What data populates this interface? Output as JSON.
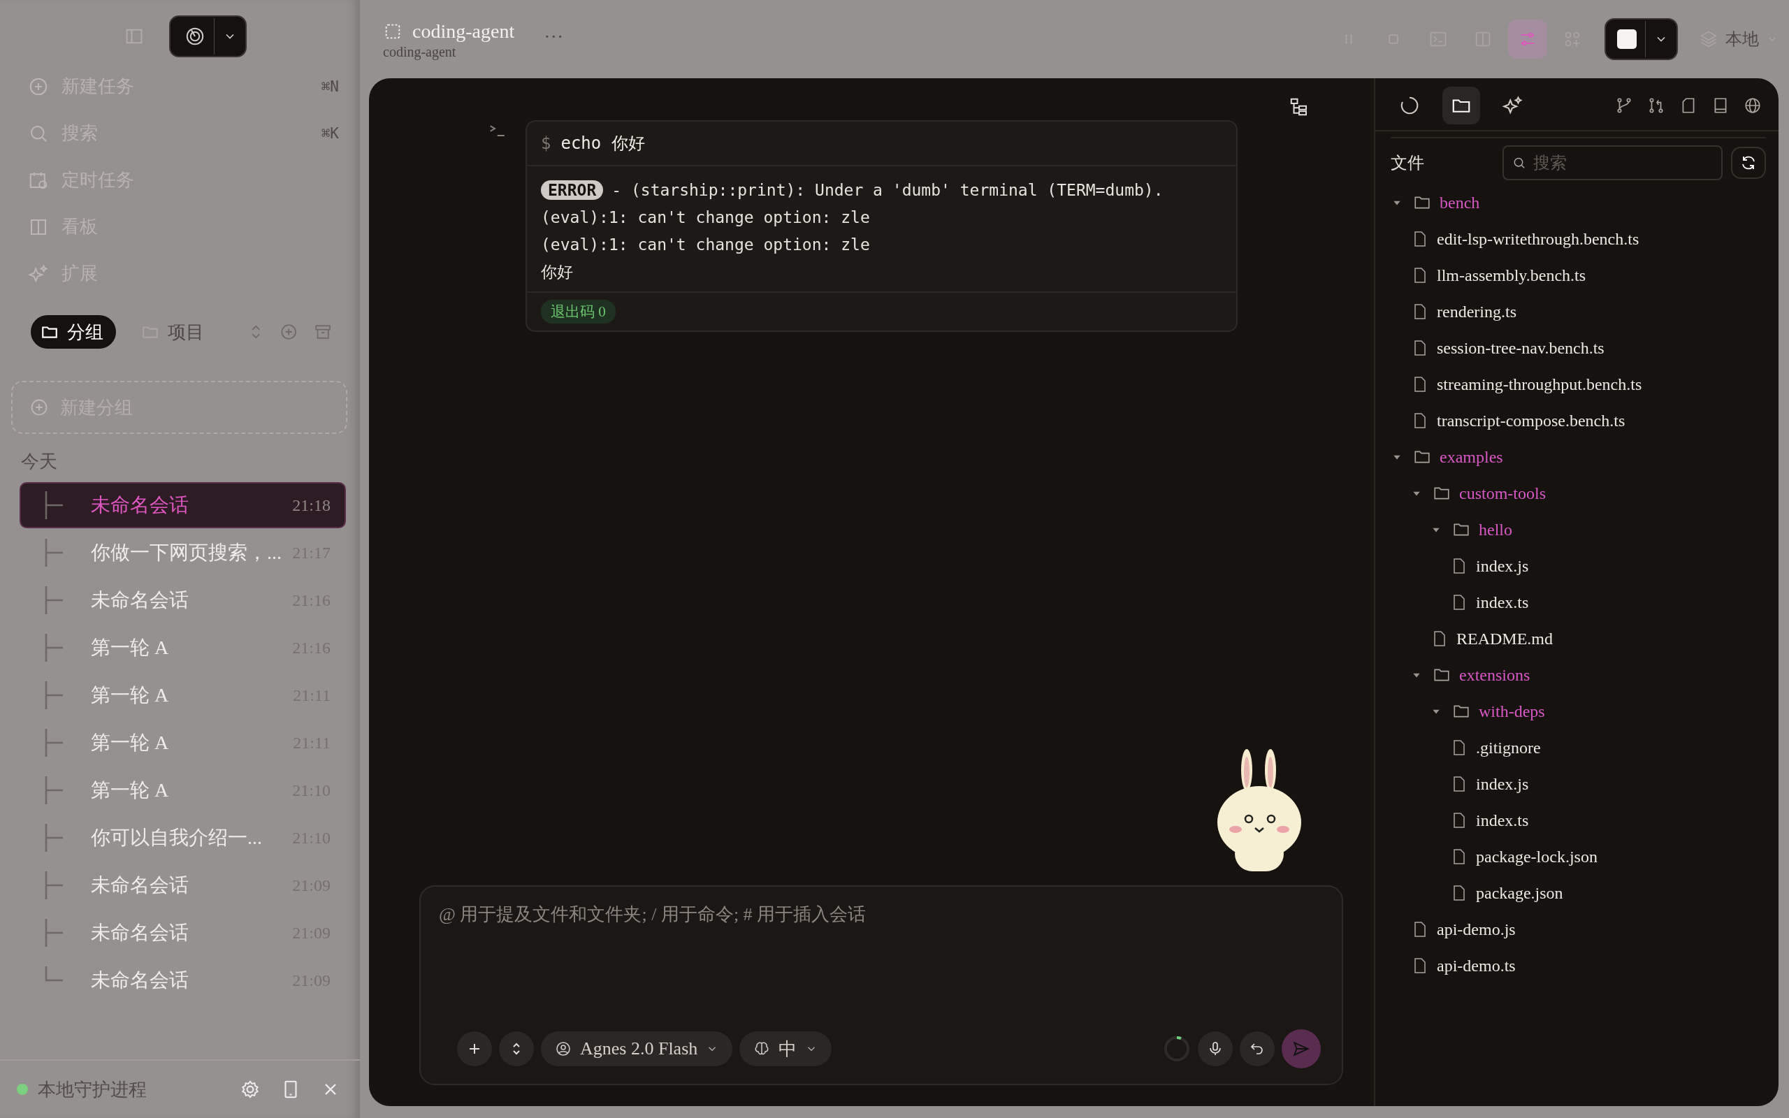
{
  "sidebar": {
    "menu": [
      {
        "label": "新建任务",
        "shortcut": "⌘N"
      },
      {
        "label": "搜索",
        "shortcut": "⌘K"
      },
      {
        "label": "定时任务"
      },
      {
        "label": "看板"
      },
      {
        "label": "扩展"
      }
    ],
    "view_toggle": [
      {
        "label": "分组",
        "selected": true
      },
      {
        "label": "项目",
        "selected": false
      }
    ],
    "new_group": "新建分组",
    "section": "今天",
    "sessions": [
      {
        "title": "未命名会话",
        "time": "21:18",
        "selected": true
      },
      {
        "title": "你做一下网页搜索，...",
        "time": "21:17",
        "selected": false
      },
      {
        "title": "未命名会话",
        "time": "21:16",
        "selected": false
      },
      {
        "title": "第一轮 A",
        "time": "21:16",
        "selected": false
      },
      {
        "title": "第一轮 A",
        "time": "21:11",
        "selected": false
      },
      {
        "title": "第一轮 A",
        "time": "21:11",
        "selected": false
      },
      {
        "title": "第一轮 A",
        "time": "21:10",
        "selected": false
      },
      {
        "title": "你可以自我介绍一...",
        "time": "21:10",
        "selected": false
      },
      {
        "title": "未命名会话",
        "time": "21:09",
        "selected": false
      },
      {
        "title": "未命名会话",
        "time": "21:09",
        "selected": false
      },
      {
        "title": "未命名会话",
        "time": "21:09",
        "selected": false
      }
    ],
    "status": "本地守护进程"
  },
  "top_bar": {
    "title": "coding-agent",
    "subtitle": "coding-agent",
    "more": "…",
    "tools": [
      {
        "selected": false
      },
      {
        "selected": false
      },
      {
        "selected": false
      },
      {
        "selected": false
      },
      {
        "selected": true
      },
      {
        "selected": false
      }
    ],
    "location": "本地"
  },
  "terminal": {
    "prompt": "$",
    "command": "echo 你好",
    "output": [
      {
        "badge": "ERROR",
        "text": "- (starship::print): Under a 'dumb' terminal (TERM=dumb)."
      },
      {
        "text": "(eval):1: can't change option: zle"
      },
      {
        "text": "(eval):1: can't change option: zle"
      },
      {
        "text": "你好"
      }
    ],
    "exit": "退出码 0"
  },
  "composer": {
    "placeholder": "@ 用于提及文件和文件夹; / 用于命令; # 用于插入会话",
    "model": "Agnes 2.0 Flash",
    "effort": "中"
  },
  "files": {
    "tabs": [
      {
        "selected": false
      },
      {
        "selected": true
      },
      {
        "selected": false
      }
    ],
    "title": "文件",
    "search_placeholder": "搜索",
    "tree": [
      {
        "kind": "folder",
        "name": "bench",
        "expanded": true,
        "children": [
          {
            "kind": "file",
            "name": "edit-lsp-writethrough.bench.ts"
          },
          {
            "kind": "file",
            "name": "llm-assembly.bench.ts"
          },
          {
            "kind": "file",
            "name": "rendering.ts"
          },
          {
            "kind": "file",
            "name": "session-tree-nav.bench.ts"
          },
          {
            "kind": "file",
            "name": "streaming-throughput.bench.ts"
          },
          {
            "kind": "file",
            "name": "transcript-compose.bench.ts"
          }
        ]
      },
      {
        "kind": "folder",
        "name": "examples",
        "expanded": true,
        "children": [
          {
            "kind": "folder",
            "name": "custom-tools",
            "expanded": true,
            "children": [
              {
                "kind": "folder",
                "name": "hello",
                "expanded": true,
                "children": [
                  {
                    "kind": "file",
                    "name": "index.js"
                  },
                  {
                    "kind": "file",
                    "name": "index.ts"
                  }
                ]
              },
              {
                "kind": "file",
                "name": "README.md"
              }
            ]
          },
          {
            "kind": "folder",
            "name": "extensions",
            "expanded": true,
            "children": [
              {
                "kind": "folder",
                "name": "with-deps",
                "expanded": true,
                "children": [
                  {
                    "kind": "file",
                    "name": ".gitignore"
                  },
                  {
                    "kind": "file",
                    "name": "index.js"
                  },
                  {
                    "kind": "file",
                    "name": "index.ts"
                  },
                  {
                    "kind": "file",
                    "name": "package-lock.json"
                  },
                  {
                    "kind": "file",
                    "name": "package.json"
                  }
                ]
              }
            ]
          },
          {
            "kind": "file",
            "name": "api-demo.js"
          },
          {
            "kind": "file",
            "name": "api-demo.ts"
          }
        ]
      }
    ]
  }
}
